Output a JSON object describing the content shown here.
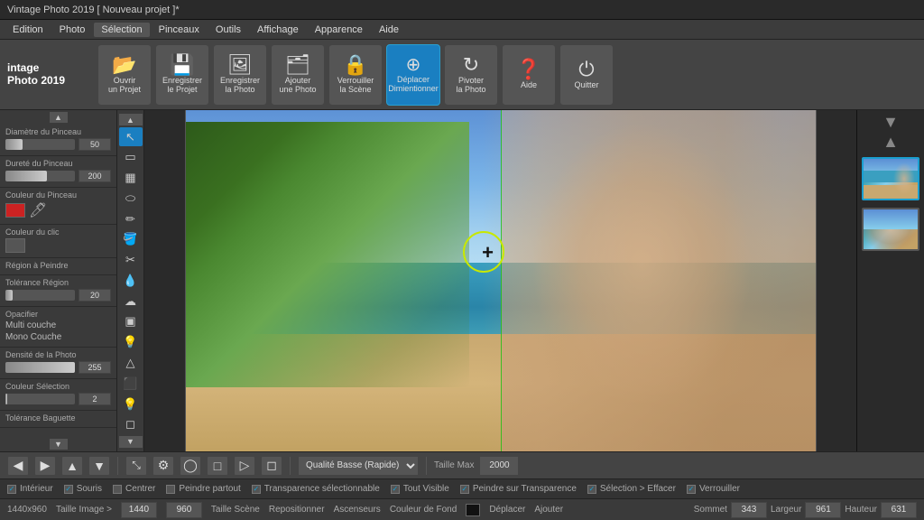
{
  "titleBar": {
    "text": "Vintage Photo 2019 [ Nouveau projet ]*"
  },
  "menuBar": {
    "items": [
      "Edition",
      "Photo",
      "Sélection",
      "Pinceaux",
      "Outils",
      "Affichage",
      "Apparence",
      "Aide"
    ]
  },
  "appTitle": {
    "line1": "intage",
    "line2": "Photo 2019"
  },
  "toolbar": {
    "buttons": [
      {
        "icon": "📁",
        "label": "Ouvrir\nun Projet"
      },
      {
        "icon": "💾",
        "label": "Enregistrer\nle Projet"
      },
      {
        "icon": "🖼",
        "label": "Enregistrer\nla Photo"
      },
      {
        "icon": "➕",
        "label": "Ajouter\nune Photo"
      },
      {
        "icon": "🔒",
        "label": "Verrouiller\nla Scène"
      },
      {
        "icon": "⊕",
        "label": "Déplacer\nDimientionner",
        "active": true
      },
      {
        "icon": "↻",
        "label": "Pivoter\nla Photo"
      },
      {
        "icon": "❓",
        "label": "Aide"
      },
      {
        "icon": "⏻",
        "label": "Quitter"
      }
    ]
  },
  "leftPanel": {
    "sections": [
      {
        "label": "Diamètre du Pinceau",
        "value": "50",
        "sliderPct": 25
      },
      {
        "label": "Dureté du Pinceau",
        "value": "200",
        "sliderPct": 60
      },
      {
        "label": "Couleur du Pinceau",
        "color": "#cc2222"
      },
      {
        "label": "Couleur du clic"
      },
      {
        "label": "Région à Peindre"
      },
      {
        "label": "Tolérance Région",
        "value": "20",
        "sliderPct": 10
      },
      {
        "label": "Opacifier"
      },
      {
        "label": "Multi couche"
      },
      {
        "label": "Mono Couche"
      },
      {
        "label": "Densité de la Photo",
        "value": "255",
        "sliderPct": 100
      },
      {
        "label": "Couleur Sélection",
        "value": "2",
        "sliderPct": 2
      },
      {
        "label": "Tolérance Baguette"
      }
    ]
  },
  "tools": {
    "items": [
      "↖",
      "◻",
      "▦",
      "◯",
      "✏",
      "🪣",
      "✂",
      "💧",
      "◻",
      "☁",
      "◻",
      "💡",
      "▲",
      "⬛",
      "💡",
      "◻",
      "▲"
    ]
  },
  "bottomToolbar": {
    "navButtons": [
      "◀",
      "▶",
      "▲",
      "▼",
      "⤡",
      "⚙",
      "◯",
      "□",
      "▷",
      "□"
    ],
    "qualityLabel": "Qualité Basse (Rapide)",
    "sizeLabel": "Taille Max",
    "sizeValue": "2000"
  },
  "statusBar": {
    "checkboxes": [
      {
        "checked": true,
        "label": "Intérieur"
      },
      {
        "checked": true,
        "label": "Souris"
      },
      {
        "checked": false,
        "label": "Centrer"
      },
      {
        "checked": false,
        "label": "Peindre partout"
      },
      {
        "checked": true,
        "label": "Transparence sélectionnable"
      },
      {
        "checked": true,
        "label": "Tout Visible"
      },
      {
        "checked": true,
        "label": "Peindre sur Transparence"
      },
      {
        "checked": true,
        "label": "Sélection > Effacer"
      },
      {
        "checked": true,
        "label": "Verrouiller"
      }
    ]
  },
  "positionBar": {
    "resolution": "1440x960",
    "imageSize": "Taille Image >",
    "width": "1440",
    "height": "960",
    "tailleScene": "Taille Scène",
    "repositionner": "Repositionner",
    "ascenseurs": "Ascenseurs",
    "couleurFond": "Couleur de Fond",
    "deplacer": "Déplacer",
    "ajouter": "Ajouter",
    "coords": {
      "sommet": "343",
      "largeur": "961",
      "hauteur": "631"
    }
  }
}
